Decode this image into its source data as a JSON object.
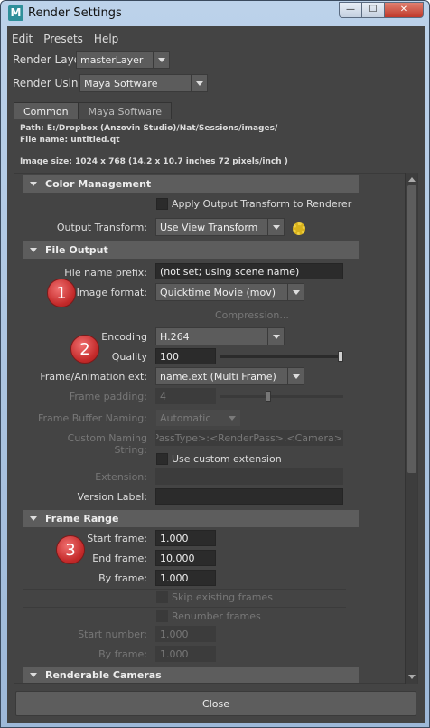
{
  "window": {
    "title": "Render Settings",
    "app_icon_letter": "M",
    "buttons": {
      "minimize": "—",
      "maximize": "☐",
      "close": "✕"
    }
  },
  "menu": [
    "Edit",
    "Presets",
    "Help"
  ],
  "render_layer": {
    "label": "Render Layer",
    "value": "masterLayer"
  },
  "render_using": {
    "label": "Render Using",
    "value": "Maya Software"
  },
  "tabs": [
    "Common",
    "Maya Software"
  ],
  "info": {
    "path": "Path: E:/Dropbox (Anzovin Studio)/Nat/Sessions/images/",
    "file_name": "File name:  untitled.qt",
    "image_size": "Image size: 1024 x 768 (14.2 x 10.7 inches 72 pixels/inch )"
  },
  "color_management": {
    "title": "Color Management",
    "apply_output": "Apply Output Transform to Renderer",
    "output_transform_label": "Output Transform:",
    "output_transform_value": "Use View Transform"
  },
  "file_output": {
    "title": "File Output",
    "file_name_prefix_label": "File name prefix:",
    "file_name_prefix_value": "(not set; using scene name)",
    "image_format_label": "Image format:",
    "image_format_value": "Quicktime Movie (mov)",
    "compression": "Compression...",
    "encoding_label": "Encoding",
    "encoding_value": "H.264",
    "quality_label": "Quality",
    "quality_value": "100",
    "quality_fraction": 1.0,
    "frame_ext_label": "Frame/Animation ext:",
    "frame_ext_value": "name.ext (Multi Frame)",
    "frame_padding_label": "Frame padding:",
    "frame_padding_value": "4",
    "fb_naming_label": "Frame Buffer Naming:",
    "fb_naming_value": "Automatic",
    "custom_naming_label": "Custom Naming String:",
    "custom_naming_value": "<RenderLayer>/<RenderPassType>:<RenderPass>.<Camera>",
    "use_custom_ext": "Use custom extension",
    "extension_label": "Extension:",
    "version_label": "Version Label:"
  },
  "frame_range": {
    "title": "Frame Range",
    "start_label": "Start frame:",
    "start_value": "1.000",
    "end_label": "End frame:",
    "end_value": "10.000",
    "by_label": "By frame:",
    "by_value": "1.000",
    "skip_existing": "Skip existing frames",
    "renumber": "Renumber frames",
    "start_number_label": "Start number:",
    "start_number_value": "1.000",
    "by_frame2_label": "By frame:",
    "by_frame2_value": "1.000"
  },
  "renderable_cameras": {
    "title": "Renderable Cameras"
  },
  "callouts": [
    "1",
    "2",
    "3"
  ],
  "close_button": "Close",
  "colors": {
    "panel_bg": "#444444",
    "section_bg": "#5d5d5d",
    "field_bg": "#2b2b2b",
    "callout_red": "#c42a2a",
    "title_bar": "#bcd2ea"
  }
}
